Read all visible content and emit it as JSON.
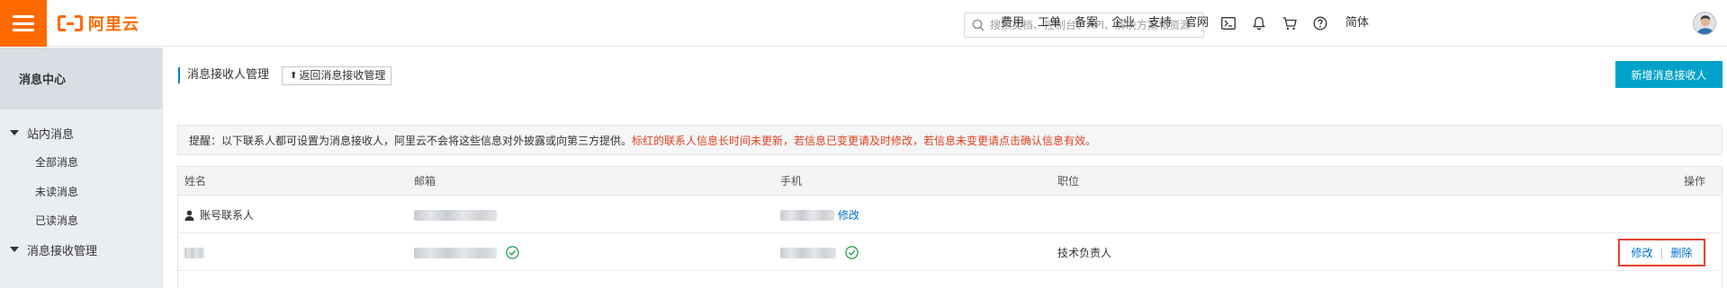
{
  "header": {
    "brand": "阿里云",
    "search_placeholder": "搜索文档、控制台、API、解决方案和资源",
    "nav": [
      "费用",
      "工单",
      "备案",
      "企业",
      "支持",
      "官网"
    ],
    "lang": "简体",
    "icons": [
      "terminal-icon",
      "bell-icon",
      "cart-icon",
      "help-icon"
    ],
    "accent": "#ff6a00"
  },
  "sidebar": {
    "title": "消息中心",
    "groups": [
      {
        "label": "站内消息",
        "items": [
          "全部消息",
          "未读消息",
          "已读消息"
        ]
      },
      {
        "label": "消息接收管理"
      }
    ]
  },
  "page": {
    "title": "消息接收人管理",
    "back_label": "返回消息接收管理",
    "add_label": "新增消息接收人",
    "notice_prefix": "提醒：以下联系人都可设置为消息接收人，阿里云不会将这些信息对外披露或向第三方提供。",
    "notice_warning": "标红的联系人信息长时间未更新，若信息已变更请及时修改，若信息未变更请点击确认信息有效。"
  },
  "table": {
    "columns": [
      "姓名",
      "邮箱",
      "手机",
      "职位",
      "操作"
    ],
    "rows": [
      {
        "name": "账号联系人",
        "phone_action": "修改",
        "position": ""
      },
      {
        "name": "",
        "position": "技术负责人",
        "edit": "修改",
        "delete": "删除"
      }
    ]
  }
}
